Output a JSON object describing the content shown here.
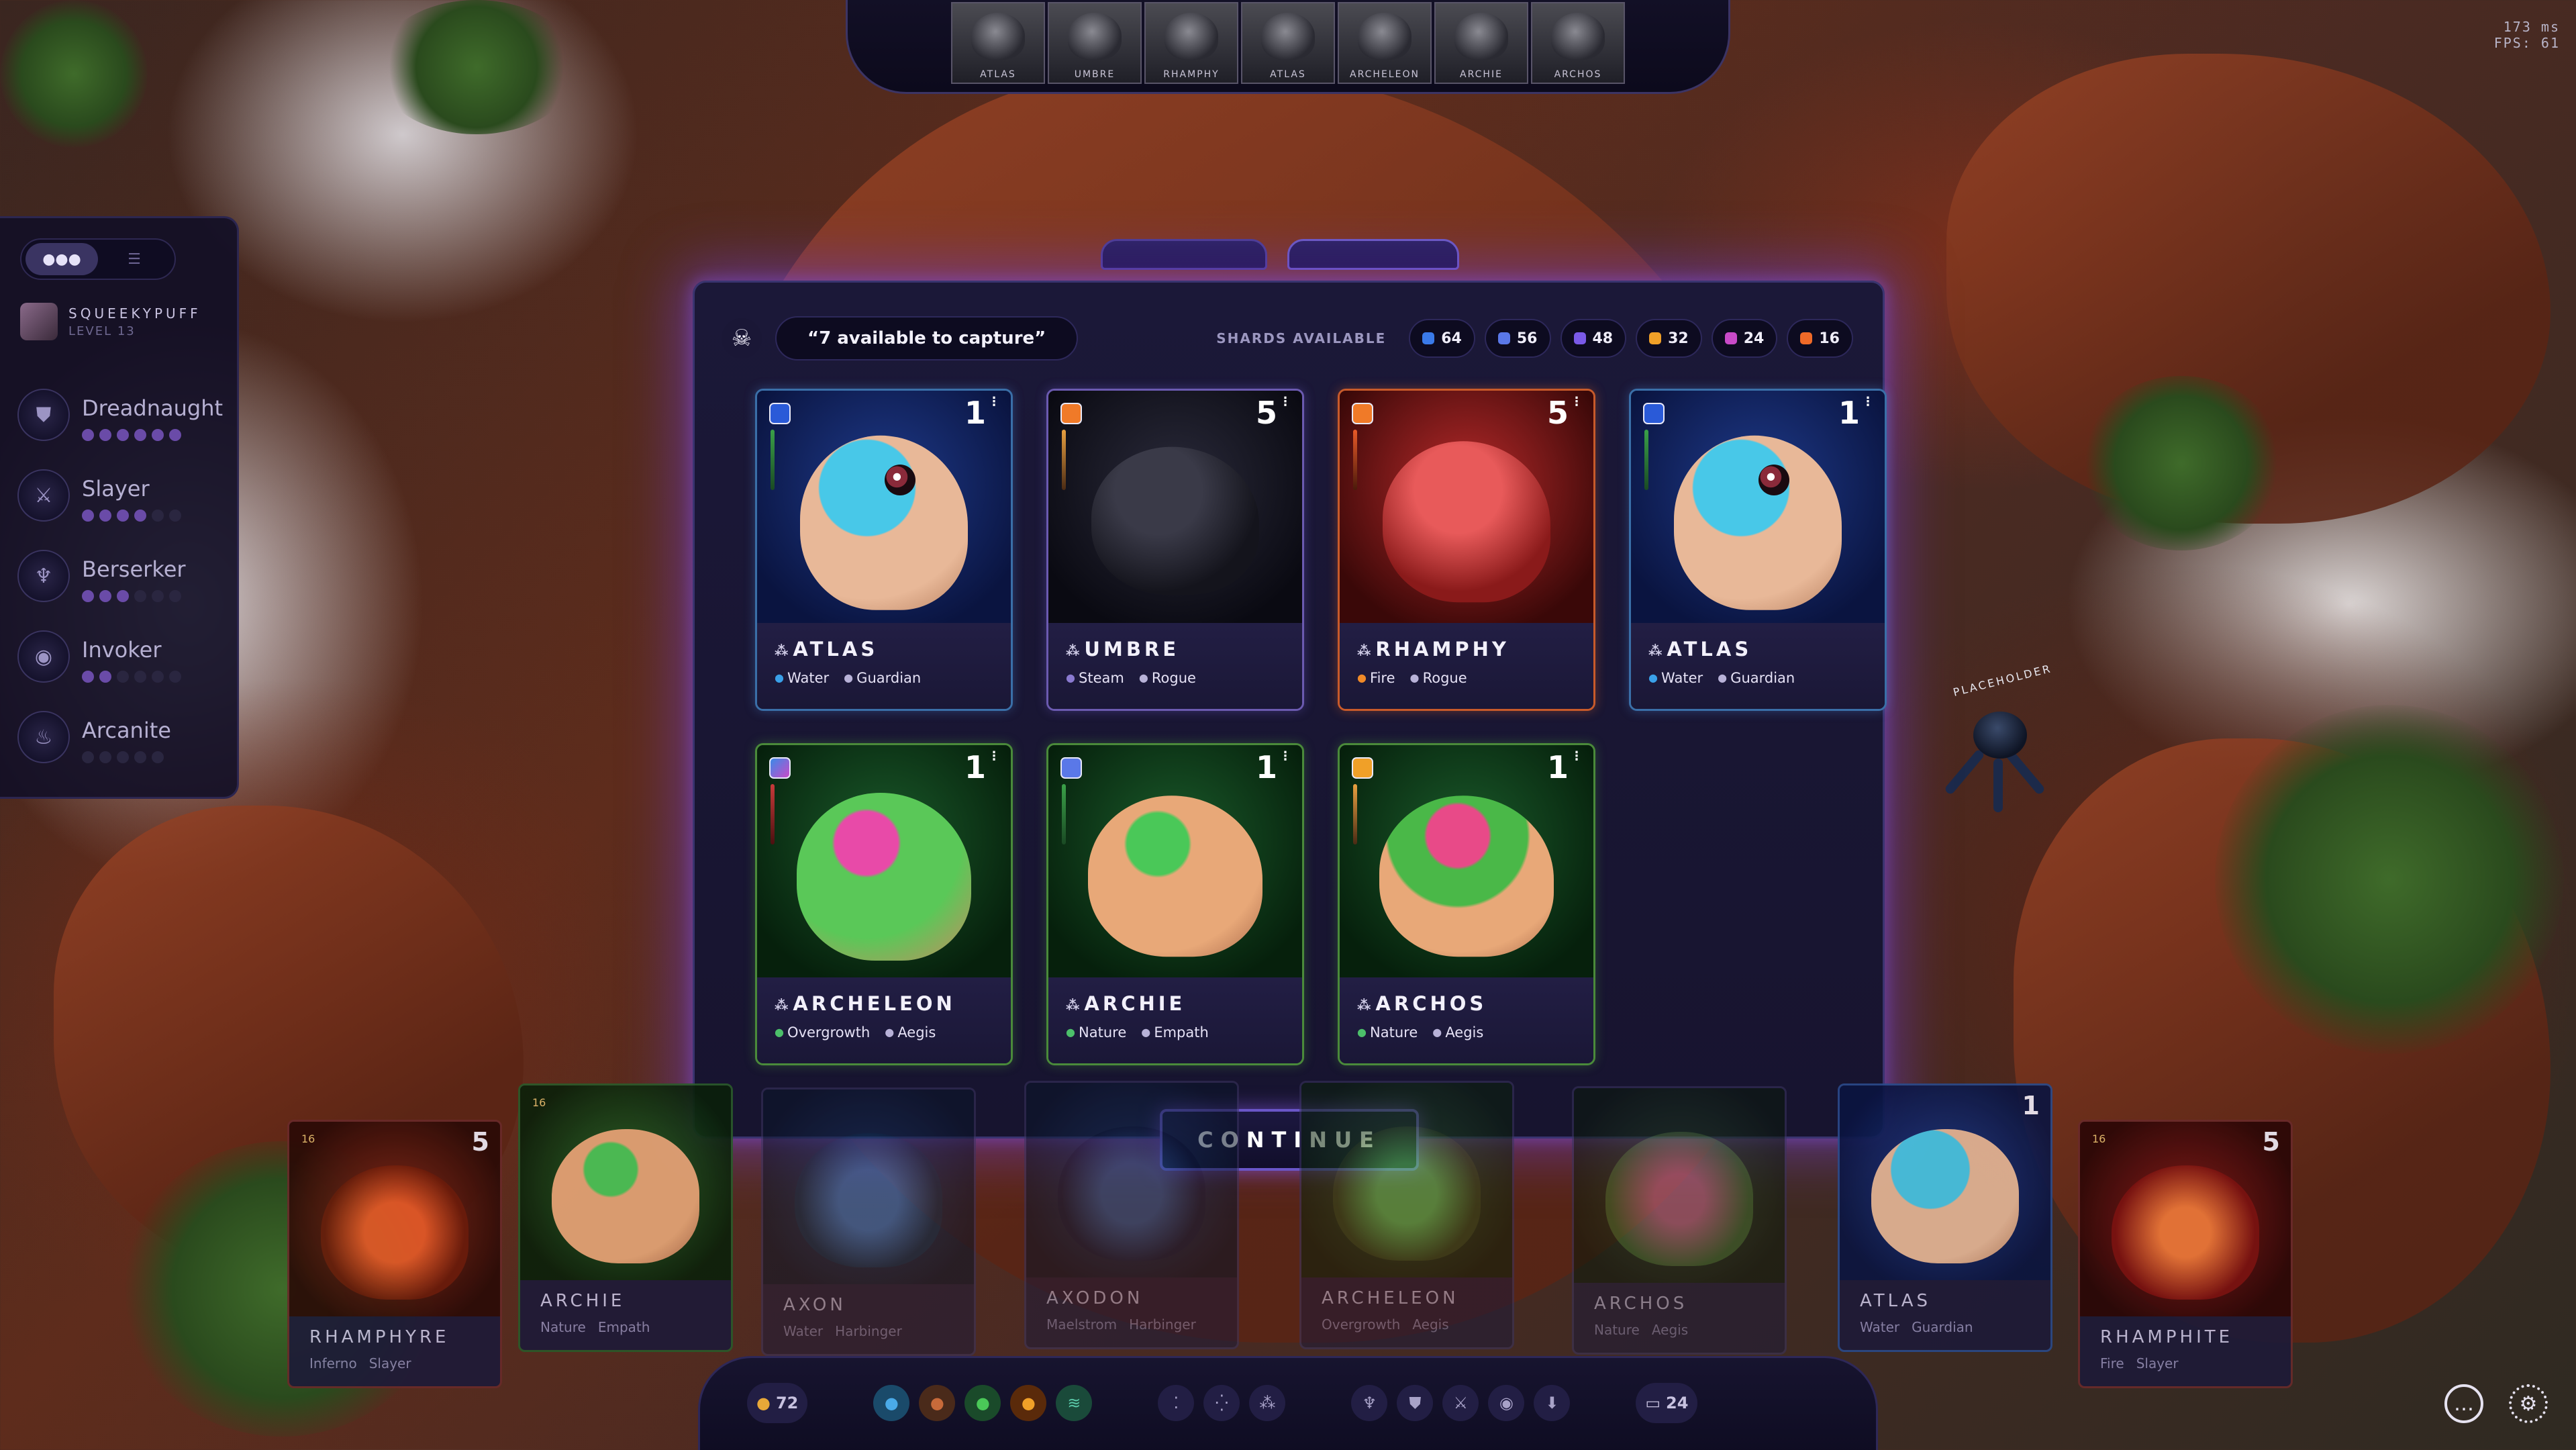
{
  "hud": {
    "latency": "173 ms",
    "fps": "FPS: 61"
  },
  "top_roster": [
    "ATLAS",
    "UMBRE",
    "RHAMPHY",
    "ATLAS",
    "ARCHELEON",
    "ARCHIE",
    "ARCHOS"
  ],
  "left_panel": {
    "player_name": "SQUEEKYPUFF",
    "player_level": "LEVEL 13",
    "classes": [
      {
        "name": "Dreadnaught",
        "icon": "shield-crest-icon",
        "pips_filled": 6,
        "pips_total": 6
      },
      {
        "name": "Slayer",
        "icon": "claw-icon",
        "pips_filled": 4,
        "pips_total": 6
      },
      {
        "name": "Berserker",
        "icon": "fang-icon",
        "pips_filled": 3,
        "pips_total": 6
      },
      {
        "name": "Invoker",
        "icon": "eye-icon",
        "pips_filled": 2,
        "pips_total": 6
      },
      {
        "name": "Arcanite",
        "icon": "flame-icon",
        "pips_filled": 0,
        "pips_total": 5
      }
    ]
  },
  "placeholder_unit": {
    "label": "PLACEHOLDER"
  },
  "modal": {
    "available_text": "“7 available to capture”",
    "shards_label": "SHARDS AVAILABLE",
    "shards": [
      {
        "count": "64",
        "color": "#3a7ae8"
      },
      {
        "count": "56",
        "color": "#5a78e8"
      },
      {
        "count": "48",
        "color": "#7a5ae8"
      },
      {
        "count": "32",
        "color": "#f0a028"
      },
      {
        "count": "24",
        "color": "#c84ac8"
      },
      {
        "count": "16",
        "color": "#f06a28"
      }
    ],
    "cards": [
      {
        "name": "ATLAS",
        "star": "1",
        "traits": [
          "Water",
          "Guardian"
        ],
        "element": "water"
      },
      {
        "name": "UMBRE",
        "star": "5",
        "traits": [
          "Steam",
          "Rogue"
        ],
        "element": "steam"
      },
      {
        "name": "RHAMPHY",
        "star": "5",
        "traits": [
          "Fire",
          "Rogue"
        ],
        "element": "fire"
      },
      {
        "name": "ATLAS",
        "star": "1",
        "traits": [
          "Water",
          "Guardian"
        ],
        "element": "water"
      },
      {
        "name": "ARCHELEON",
        "star": "1",
        "traits": [
          "Overgrowth",
          "Aegis"
        ],
        "element": "nature"
      },
      {
        "name": "ARCHIE",
        "star": "1",
        "traits": [
          "Nature",
          "Empath"
        ],
        "element": "nature"
      },
      {
        "name": "ARCHOS",
        "star": "1",
        "traits": [
          "Nature",
          "Aegis"
        ],
        "element": "nature"
      }
    ],
    "continue_label": "CONTINUE"
  },
  "hand": [
    {
      "name": "RHAMPHYRE",
      "star": "5",
      "cost": "16",
      "traits": [
        "Inferno",
        "Slayer"
      ]
    },
    {
      "name": "ARCHIE",
      "star": "",
      "cost": "16",
      "traits": [
        "Nature",
        "Empath"
      ]
    },
    {
      "name": "AXON",
      "star": "",
      "cost": "",
      "traits": [
        "Water",
        "Harbinger"
      ]
    },
    {
      "name": "AXODON",
      "star": "",
      "cost": "",
      "traits": [
        "Maelstrom",
        "Harbinger"
      ]
    },
    {
      "name": "ARCHELEON",
      "star": "",
      "cost": "",
      "traits": [
        "Overgrowth",
        "Aegis"
      ]
    },
    {
      "name": "ARCHOS",
      "star": "",
      "cost": "",
      "traits": [
        "Nature",
        "Aegis"
      ]
    },
    {
      "name": "ATLAS",
      "star": "1",
      "cost": "",
      "traits": [
        "Water",
        "Guardian"
      ]
    },
    {
      "name": "RHAMPHITE",
      "star": "5",
      "cost": "16",
      "traits": [
        "Fire",
        "Slayer"
      ]
    }
  ],
  "bottom_bar": {
    "gold": "72",
    "deck_count": "24"
  }
}
